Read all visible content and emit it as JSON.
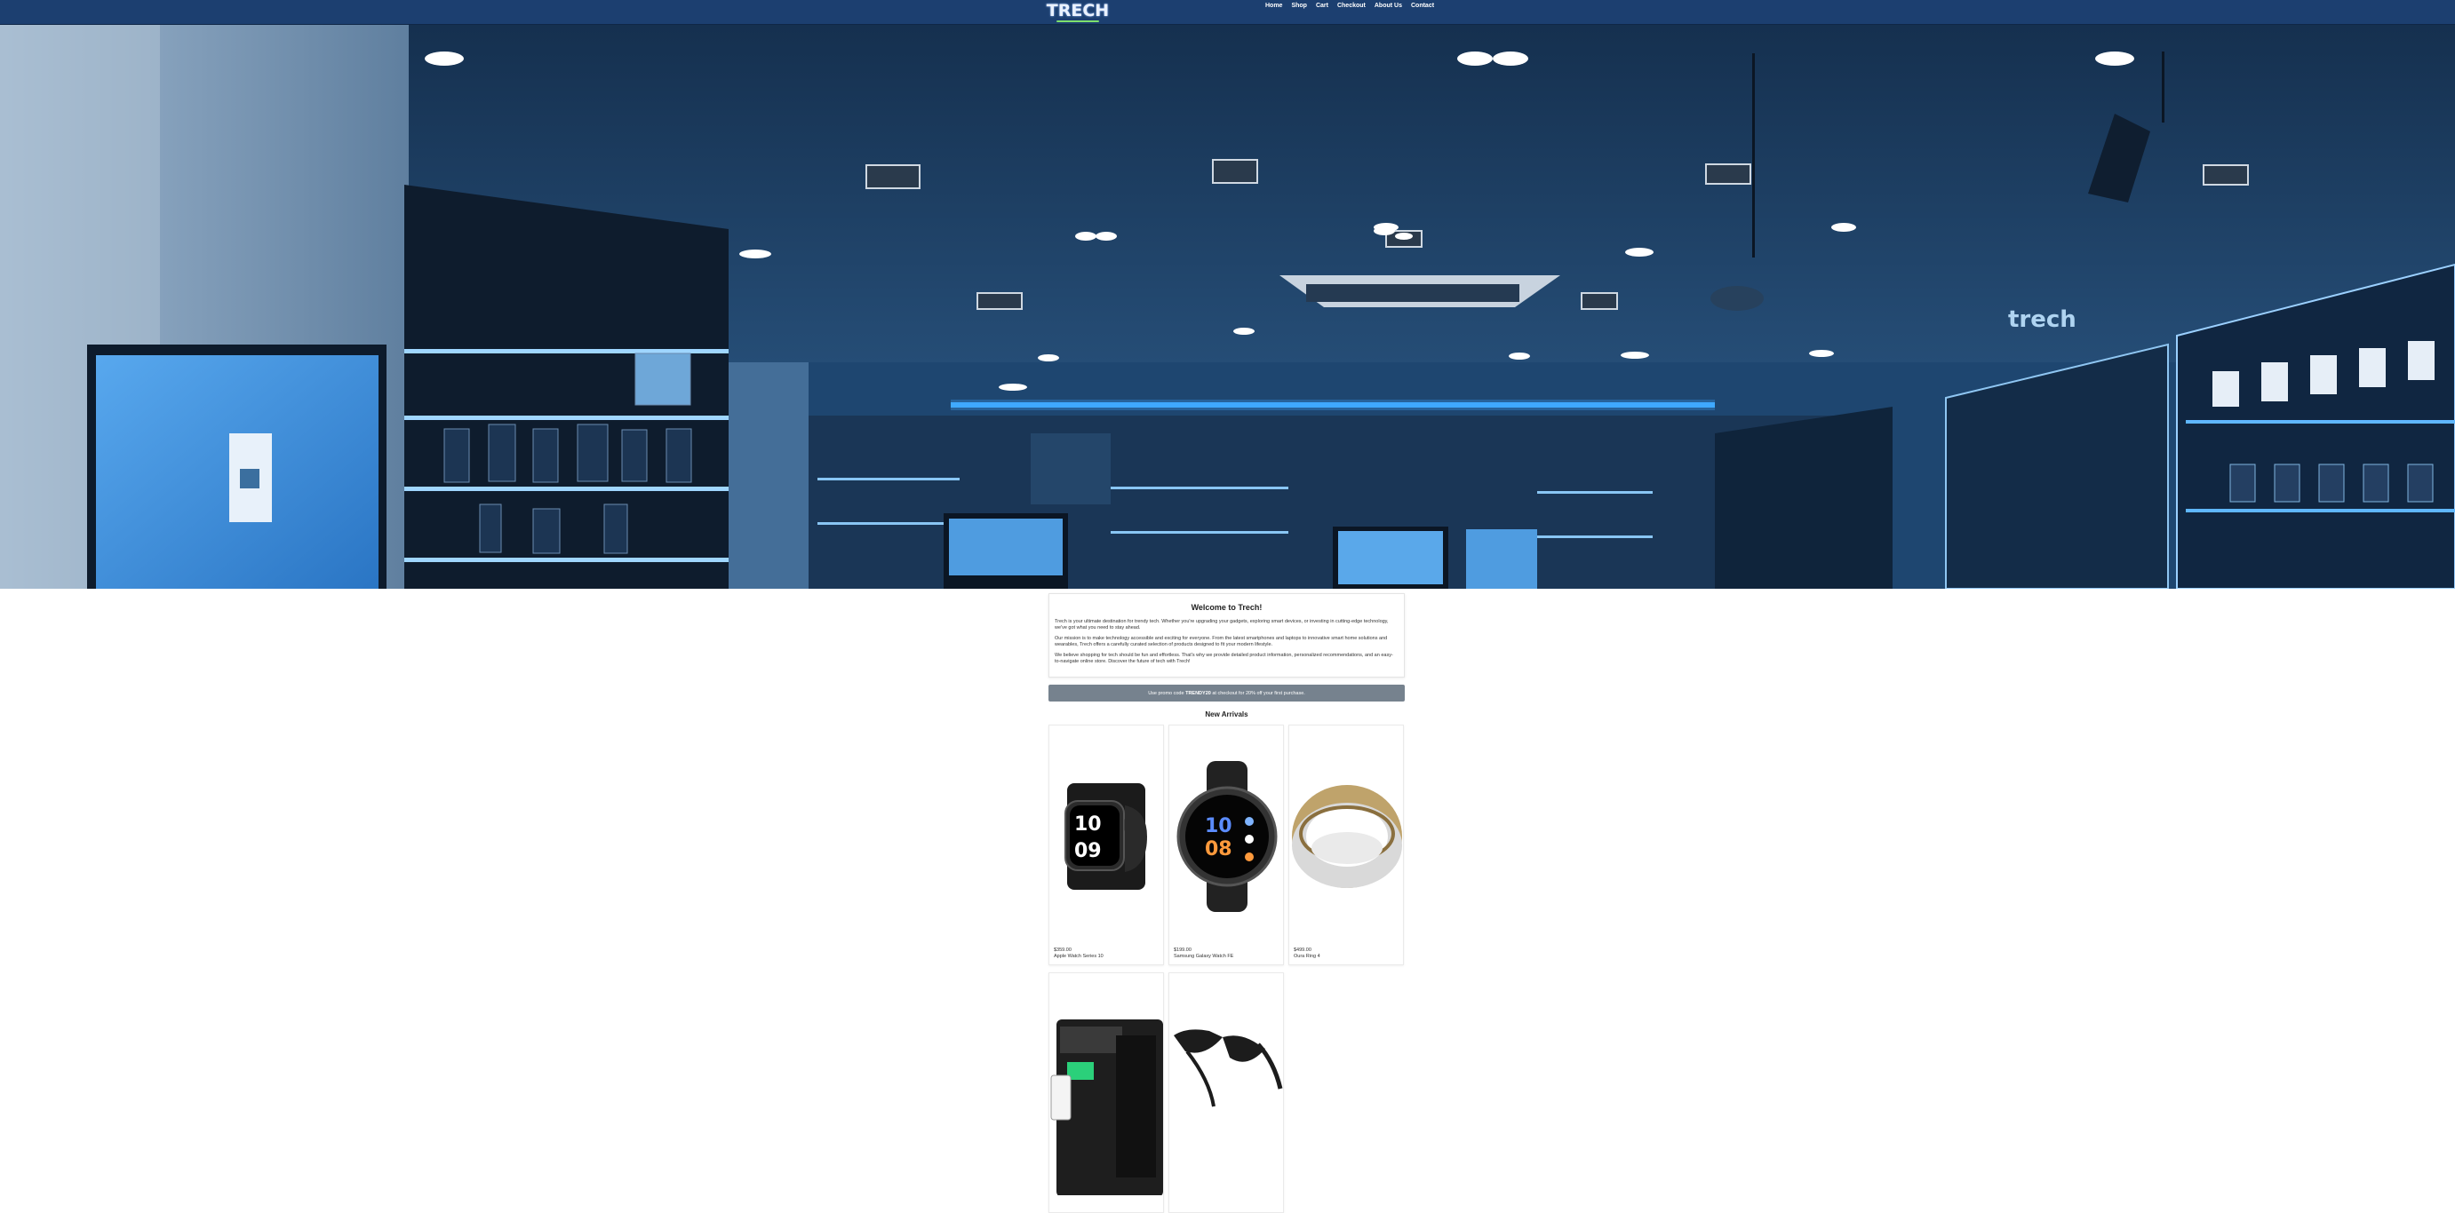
{
  "brand": {
    "logo_text": "TRECH",
    "accent": "#7ee06c",
    "nav_bg": "#1c3f70"
  },
  "nav": {
    "items": [
      {
        "label": "Home"
      },
      {
        "label": "Shop"
      },
      {
        "label": "Cart"
      },
      {
        "label": "Checkout"
      },
      {
        "label": "About Us"
      },
      {
        "label": "Contact"
      }
    ]
  },
  "hero": {
    "image_icon": "store-interior-image"
  },
  "welcome": {
    "title": "Welcome to Trech!",
    "paragraphs": [
      "Trech is your ultimate destination for trendy tech. Whether you're upgrading your gadgets, exploring smart devices, or investing in cutting-edge technology, we've got what you need to stay ahead.",
      "Our mission is to make technology accessible and exciting for everyone. From the latest smartphones and laptops to innovative smart home solutions and wearables, Trech offers a carefully curated selection of products designed to fit your modern lifestyle.",
      "We believe shopping for tech should be fun and effortless. That's why we provide detailed product information, personalized recommendations, and an easy-to-navigate online store. Discover the future of tech with Trech!"
    ]
  },
  "promo": {
    "prefix": "Use promo code ",
    "code": "TRENDY20",
    "suffix": " at checkout for 20% off your first purchase."
  },
  "arrivals": {
    "title": "New Arrivals",
    "products": [
      {
        "price": "$359.00",
        "name": "Apple Watch Series 10",
        "icon": "apple-watch-image"
      },
      {
        "price": "$199.00",
        "name": "Samsung Galaxy Watch FE",
        "icon": "galaxy-watch-image"
      },
      {
        "price": "$499.00",
        "name": "Oura Ring 4",
        "icon": "oura-ring-image"
      },
      {
        "price": "",
        "name": "",
        "icon": "smart-device-image"
      },
      {
        "price": "",
        "name": "",
        "icon": "smart-glasses-image"
      }
    ]
  }
}
